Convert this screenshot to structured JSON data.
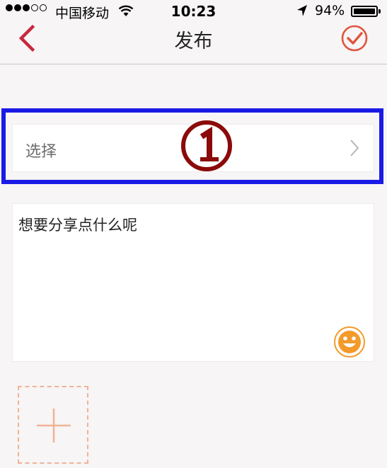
{
  "status_bar": {
    "carrier": "中国移动",
    "time": "10:23",
    "battery_percent": "94%",
    "signal_bars_filled": 3,
    "signal_bars_total": 5,
    "battery_level": 0.94
  },
  "nav": {
    "title": "发布",
    "back_icon": "chevron-left-icon",
    "confirm_icon": "check-circle-icon",
    "accent_color": "#c8283c",
    "confirm_color": "#e0543c"
  },
  "selector": {
    "label": "选择",
    "icon": "chevron-right-icon"
  },
  "annotation": {
    "marker": "①",
    "highlight_color": "#1a1ae6",
    "marker_color": "#8b0a0a"
  },
  "composer": {
    "placeholder": "想要分享点什么呢",
    "emoji_icon": "smiley-icon",
    "emoji_color": "#f39a2a"
  },
  "media": {
    "add_icon": "plus-icon",
    "add_color": "#f0b396"
  }
}
